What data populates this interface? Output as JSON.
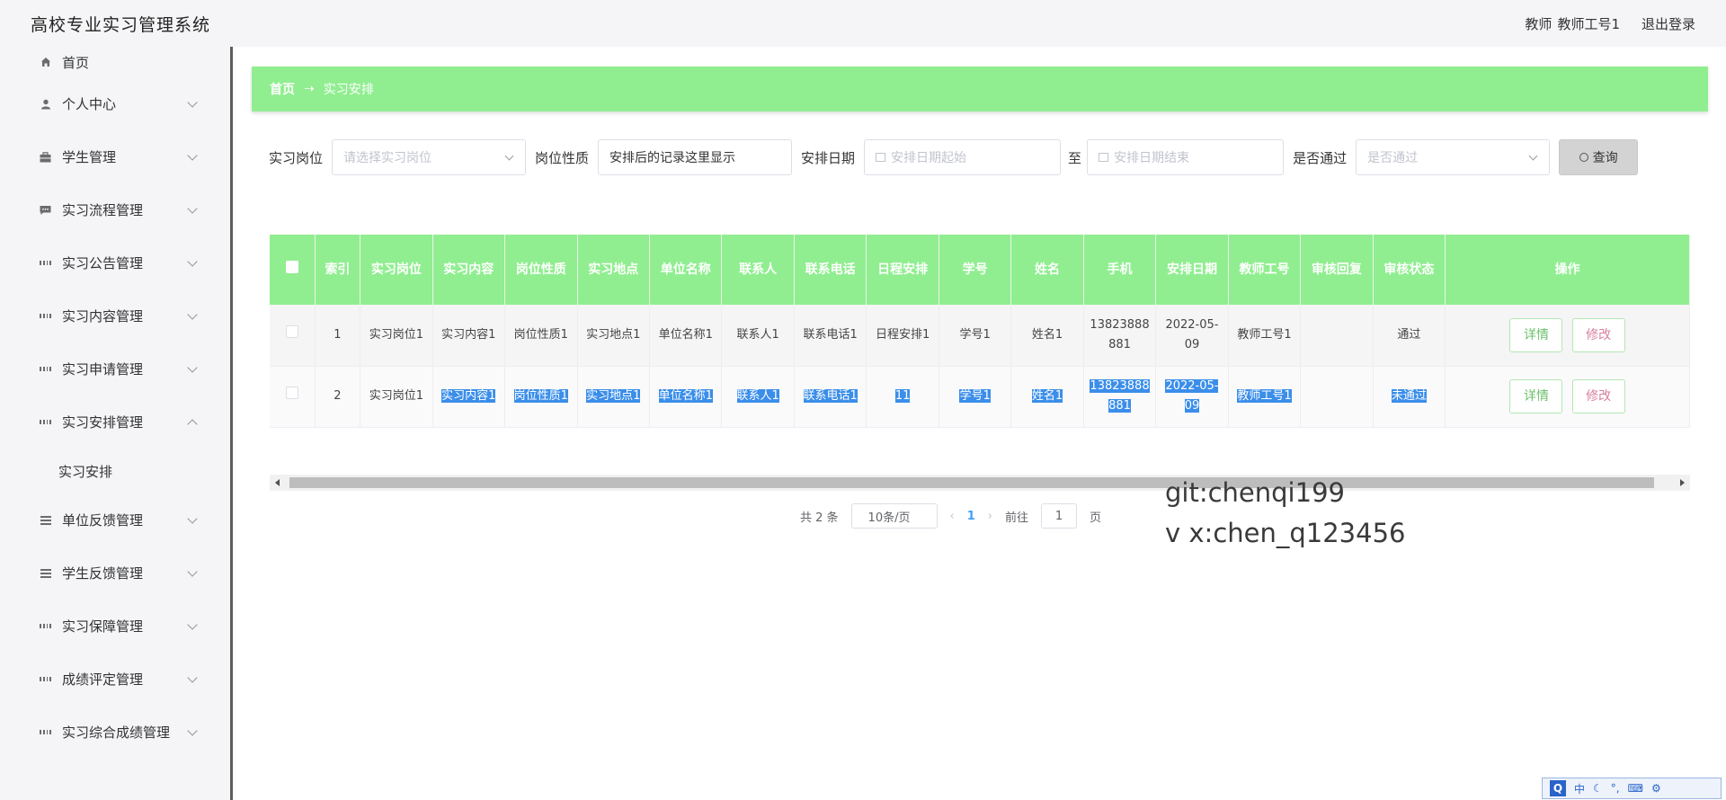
{
  "app": {
    "title": "高校专业实习管理系统"
  },
  "topbar": {
    "role": "教师",
    "username": "教师工号1",
    "logout": "退出登录"
  },
  "sidebar": {
    "items": [
      {
        "label": "首页",
        "icon": "home-icon"
      },
      {
        "label": "个人中心",
        "icon": "user-icon"
      },
      {
        "label": "学生管理",
        "icon": "briefcase-icon"
      },
      {
        "label": "实习流程管理",
        "icon": "chat-icon"
      },
      {
        "label": "实习公告管理",
        "icon": "grid-icon"
      },
      {
        "label": "实习内容管理",
        "icon": "grid-icon"
      },
      {
        "label": "实习申请管理",
        "icon": "grid-icon"
      },
      {
        "label": "实习安排管理",
        "icon": "grid-icon"
      },
      {
        "label": "单位反馈管理",
        "icon": "list-icon"
      },
      {
        "label": "学生反馈管理",
        "icon": "list-icon"
      },
      {
        "label": "实习保障管理",
        "icon": "grid-icon"
      },
      {
        "label": "成绩评定管理",
        "icon": "grid-icon"
      },
      {
        "label": "实习综合成绩管理",
        "icon": "grid-icon"
      }
    ],
    "submenu": {
      "label": "实习安排"
    }
  },
  "breadcrumb": {
    "home": "首页",
    "arrow": "➝",
    "current": "实习安排"
  },
  "filters": {
    "position_label": "实习岗位",
    "position_placeholder": "请选择实习岗位",
    "nature_label": "岗位性质",
    "nature_value": "安排后的记录这里显示",
    "date_label": "安排日期",
    "date_start_placeholder": "安排日期起始",
    "date_to": "至",
    "date_end_placeholder": "安排日期结束",
    "pass_label": "是否通过",
    "pass_placeholder": "是否通过",
    "query_button": "查询"
  },
  "table": {
    "headers": [
      "索引",
      "实习岗位",
      "实习内容",
      "岗位性质",
      "实习地点",
      "单位名称",
      "联系人",
      "联系电话",
      "日程安排",
      "学号",
      "姓名",
      "手机",
      "安排日期",
      "教师工号",
      "审核回复",
      "审核状态",
      "操作"
    ],
    "rows": [
      [
        "1",
        "实习岗位1",
        "实习内容1",
        "岗位性质1",
        "实习地点1",
        "单位名称1",
        "联系人1",
        "联系电话1",
        "日程安排1",
        "学号1",
        "姓名1",
        "13823888881",
        "2022-05-09",
        "教师工号1",
        "",
        "通过"
      ],
      [
        "2",
        "实习岗位1",
        "实习内容1",
        "岗位性质1",
        "实习地点1",
        "单位名称1",
        "联系人1",
        "联系电话1",
        "11",
        "学号1",
        "姓名1",
        "13823888881",
        "2022-05-09",
        "教师工号1",
        "",
        "未通过"
      ]
    ],
    "actions": {
      "detail": "详情",
      "edit": "修改"
    }
  },
  "pagination": {
    "total": "共 2 条",
    "page_size": "10条/页",
    "current_page": "1",
    "goto_label": "前往",
    "goto_value": "1",
    "page_unit": "页"
  },
  "watermark": {
    "line1": "git:chenqi199",
    "line2": "v x:chen_q123456"
  },
  "ime": {
    "logo": "Q",
    "lang": "中"
  }
}
